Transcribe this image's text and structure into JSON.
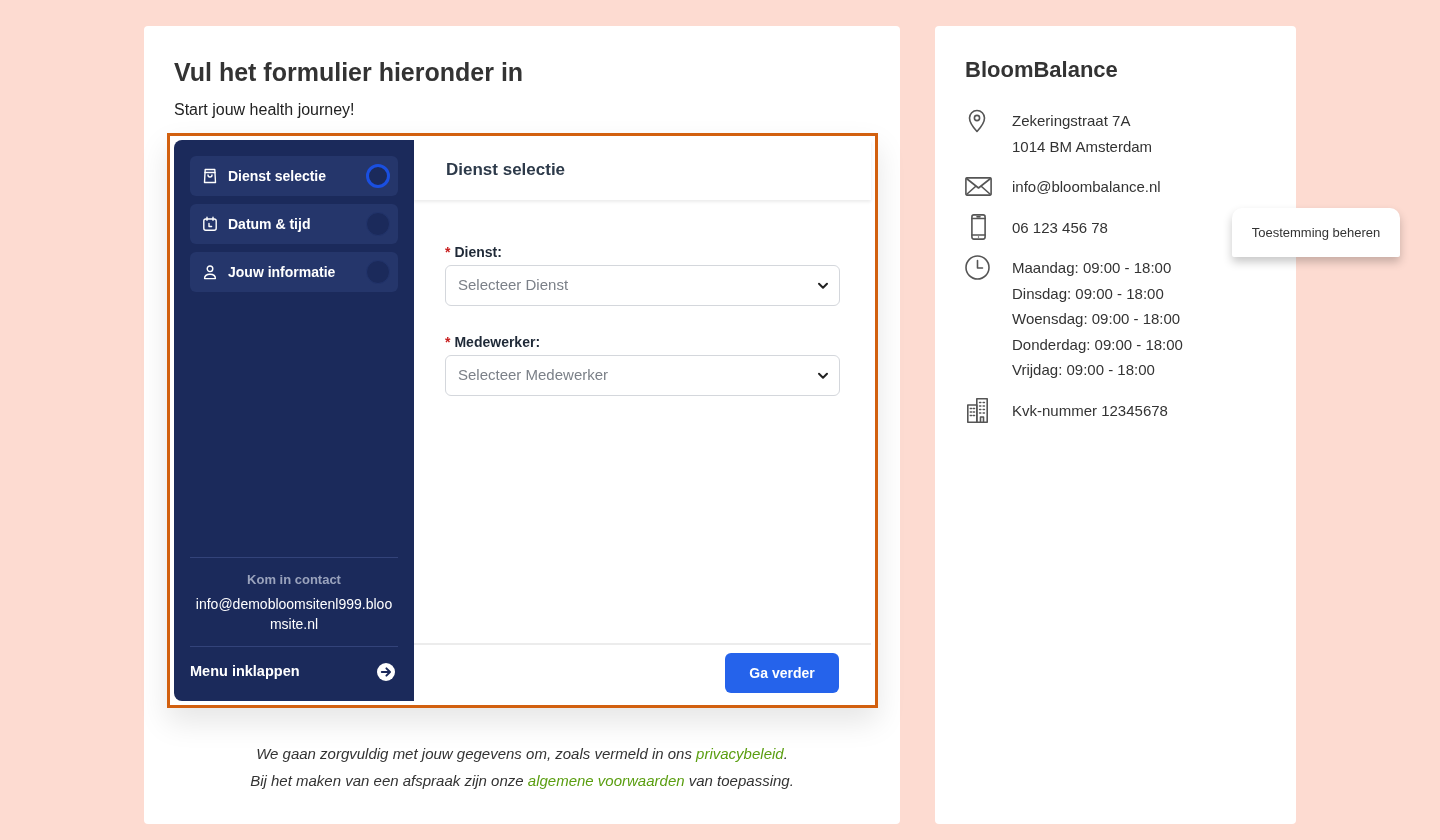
{
  "form": {
    "title": "Vul het formulier hieronder in",
    "subtitle": "Start jouw health journey!"
  },
  "booking": {
    "steps": [
      {
        "label": "Dienst selectie",
        "selected": true
      },
      {
        "label": "Datum & tijd",
        "selected": false
      },
      {
        "label": "Jouw informatie",
        "selected": false
      }
    ],
    "contact": {
      "heading": "Kom in contact",
      "email": "info@demobloomsitenl999.bloomsite.nl"
    },
    "collapse_label": "Menu inklappen",
    "panel_title": "Dienst selectie",
    "fields": [
      {
        "required_mark": "*",
        "label": "Dienst:",
        "placeholder": "Selecteer Dienst"
      },
      {
        "required_mark": "*",
        "label": "Medewerker:",
        "placeholder": "Selecteer Medewerker"
      }
    ],
    "next_button": "Ga verder"
  },
  "notice": [
    {
      "before": "We gaan zorgvuldig met jouw gegevens om, zoals vermeld in ons ",
      "link": "privacybeleid",
      "after": "."
    },
    {
      "before": "Bij het maken van een afspraak zijn onze ",
      "link": "algemene voorwaarden",
      "after": " van toepassing."
    }
  ],
  "business": {
    "name": "BloomBalance",
    "address_lines": [
      "Zekeringstraat 7A",
      "1014 BM Amsterdam"
    ],
    "email": "info@bloombalance.nl",
    "phone": "06 123 456 78",
    "hours": [
      "Maandag: 09:00 - 18:00",
      "Dinsdag: 09:00 - 18:00",
      "Woensdag: 09:00 - 18:00",
      "Donderdag: 09:00 - 18:00",
      "Vrijdag: 09:00 - 18:00"
    ],
    "kvk": "Kvk-nummer 12345678"
  },
  "consent_popup": {
    "label": "Toestemming beheren"
  }
}
